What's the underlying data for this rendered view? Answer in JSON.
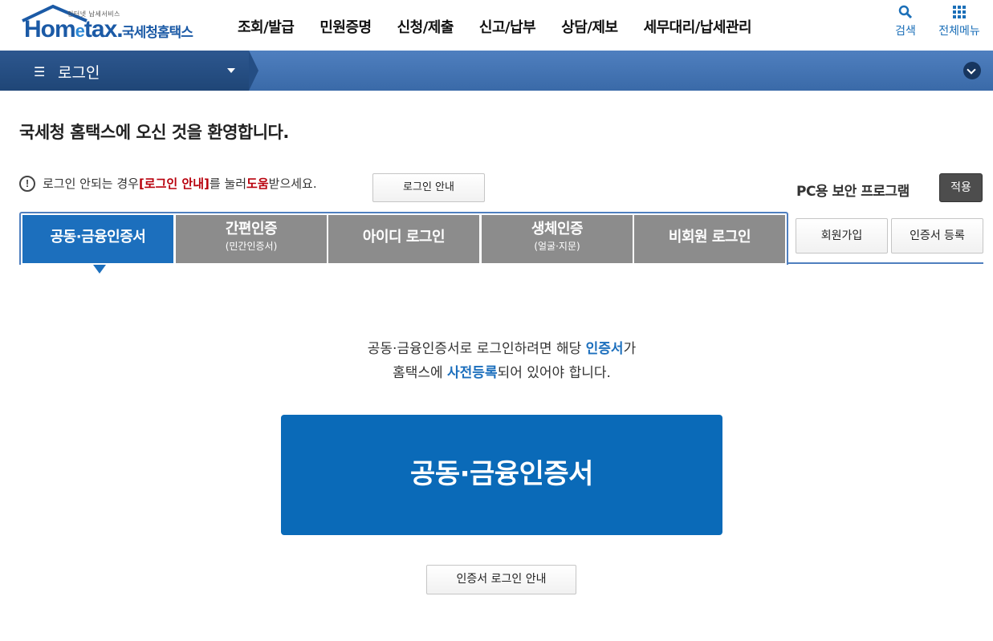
{
  "header": {
    "logo": {
      "tagline": "인터넷 납세서비스",
      "wordmark_pre": "Hom",
      "wordmark_e": "e",
      "wordmark_post": "tax.",
      "korean": "국세청홈택스"
    },
    "nav": [
      "조회/발급",
      "민원증명",
      "신청/제출",
      "신고/납부",
      "상담/제보",
      "세무대리/납세관리"
    ],
    "search_label": "검색",
    "allmenu_label": "전체메뉴"
  },
  "loginbar": {
    "menu_icon": "hamburger-icon",
    "title": "로그인"
  },
  "welcome": "국세청 홈택스에 오신 것을 환영합니다.",
  "notice": {
    "prefix": "로그인 안되는 경우 ",
    "link1": "[로그인 안내]",
    "middle": "를 눌러 ",
    "link2": "도움",
    "suffix": "받으세요.",
    "button": "로그인 안내"
  },
  "pc_security": {
    "label": "PC용 보안 프로그램",
    "apply": "적용"
  },
  "tabs": [
    {
      "main": "공동·금융인증서",
      "sub": "",
      "active": true
    },
    {
      "main": "간편인증",
      "sub": "(민간인증서)",
      "active": false
    },
    {
      "main": "아이디 로그인",
      "sub": "",
      "active": false
    },
    {
      "main": "생체인증",
      "sub": "(얼굴·지문)",
      "active": false
    },
    {
      "main": "비회원 로그인",
      "sub": "",
      "active": false
    }
  ],
  "side_buttons": {
    "join": "회원가입",
    "cert_register": "인증서 등록"
  },
  "message": {
    "line1_pre": "공동·금융인증서로 로그인하려면 해당 ",
    "line1_em": "인증서",
    "line1_post": "가",
    "line2_pre": "홈택스에 ",
    "line2_em": "사전등록",
    "line2_post": "되어 있어야 합니다."
  },
  "main_button": "공동·금융인증서",
  "guide_button": "인증서 로그인 안내",
  "colors": {
    "primary": "#1c6fbd",
    "button_blue": "#0a6ab8",
    "tab_inactive": "#8c8c8c",
    "notice_red": "#b8000c"
  }
}
